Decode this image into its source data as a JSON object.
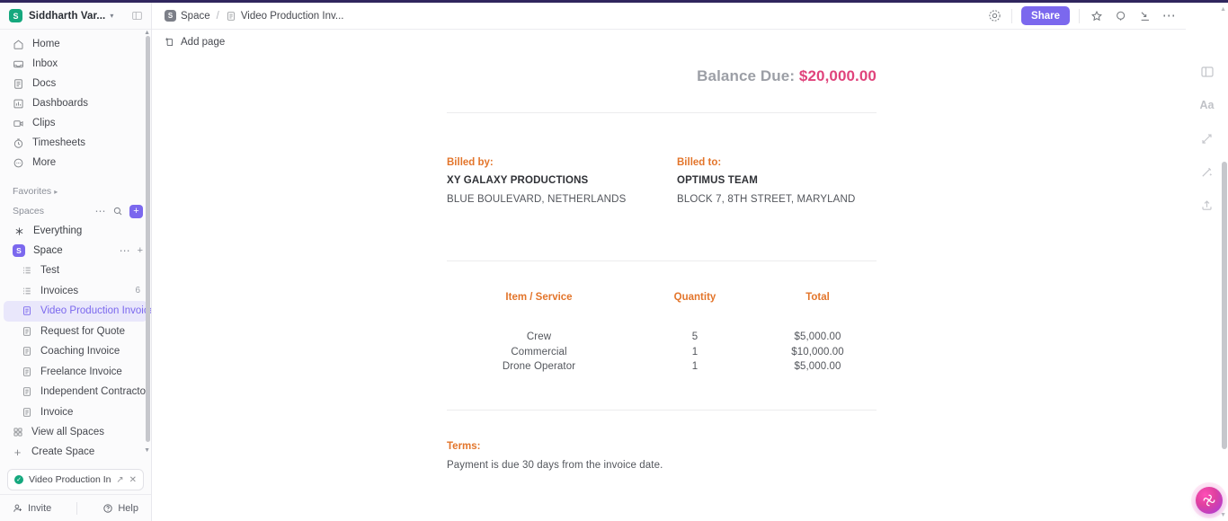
{
  "workspace": {
    "badge": "S",
    "name": "Siddharth Var...",
    "caret": "chevron-down"
  },
  "sidebar": {
    "nav": [
      {
        "label": "Home",
        "icon": "home-icon"
      },
      {
        "label": "Inbox",
        "icon": "inbox-icon"
      },
      {
        "label": "Docs",
        "icon": "docs-icon"
      },
      {
        "label": "Dashboards",
        "icon": "dashboards-icon"
      },
      {
        "label": "Clips",
        "icon": "clips-icon"
      },
      {
        "label": "Timesheets",
        "icon": "timesheets-icon"
      },
      {
        "label": "More",
        "icon": "more-icon"
      }
    ],
    "favorites_label": "Favorites",
    "spaces_label": "Spaces",
    "everything_label": "Everything",
    "space": {
      "badge": "S",
      "label": "Space"
    },
    "docs": [
      {
        "label": "Test",
        "icon": "list-icon",
        "count": "",
        "active": false
      },
      {
        "label": "Invoices",
        "icon": "list-icon",
        "count": "6",
        "active": false
      },
      {
        "label": "Video Production Invoice",
        "icon": "doc-icon",
        "count": "",
        "active": true
      },
      {
        "label": "Request for Quote",
        "icon": "doc-icon",
        "count": "",
        "active": false
      },
      {
        "label": "Coaching Invoice",
        "icon": "doc-icon",
        "count": "",
        "active": false
      },
      {
        "label": "Freelance Invoice",
        "icon": "doc-icon",
        "count": "",
        "active": false
      },
      {
        "label": "Independent Contractor ...",
        "icon": "doc-icon",
        "count": "",
        "active": false
      },
      {
        "label": "Invoice",
        "icon": "doc-icon",
        "count": "",
        "active": false
      }
    ],
    "view_all_spaces": "View all Spaces",
    "create_space": "Create Space",
    "open_tab": "Video Production Invoi...",
    "footer": {
      "invite": "Invite",
      "help": "Help"
    }
  },
  "topbar": {
    "breadcrumb": {
      "space_badge": "S",
      "space": "Space",
      "separator": "/",
      "doc": "Video Production Inv..."
    },
    "share_label": "Share",
    "icons": [
      "settings-icon",
      "star-icon",
      "search-icon",
      "collapse-icon",
      "more-horizontal-icon"
    ]
  },
  "doc_toolbar": {
    "add_page_label": "Add page",
    "add_page_icon": "add-page-icon"
  },
  "document": {
    "balance": {
      "label": "Balance Due:",
      "amount": "$20,000.00",
      "amount_color": "#e0447c"
    },
    "billed_by": {
      "label": "Billed by:",
      "name": "XY GALAXY PRODUCTIONS",
      "address": "BLUE BOULEVARD, NETHERLANDS"
    },
    "billed_to": {
      "label": "Billed to:",
      "name": "OPTIMUS TEAM",
      "address": "BLOCK 7, 8TH STREET, MARYLAND"
    },
    "table": {
      "headers": [
        "Item / Service",
        "Quantity",
        "Total"
      ],
      "rows": [
        [
          "Crew",
          "5",
          "$5,000.00"
        ],
        [
          "Commercial",
          "1",
          "$10,000.00"
        ],
        [
          "Drone Operator",
          "1",
          "$5,000.00"
        ]
      ]
    },
    "terms": {
      "label": "Terms:",
      "text": "Payment is due 30 days from the invoice date."
    },
    "accent_color": "#e3752b"
  },
  "right_rail": {
    "icons": [
      "panel-toggle-icon",
      "text-format-icon",
      "expand-icon",
      "magic-wand-icon",
      "upload-icon"
    ],
    "aa_label": "Aa",
    "ai_orb": "clickup-brain-icon"
  }
}
